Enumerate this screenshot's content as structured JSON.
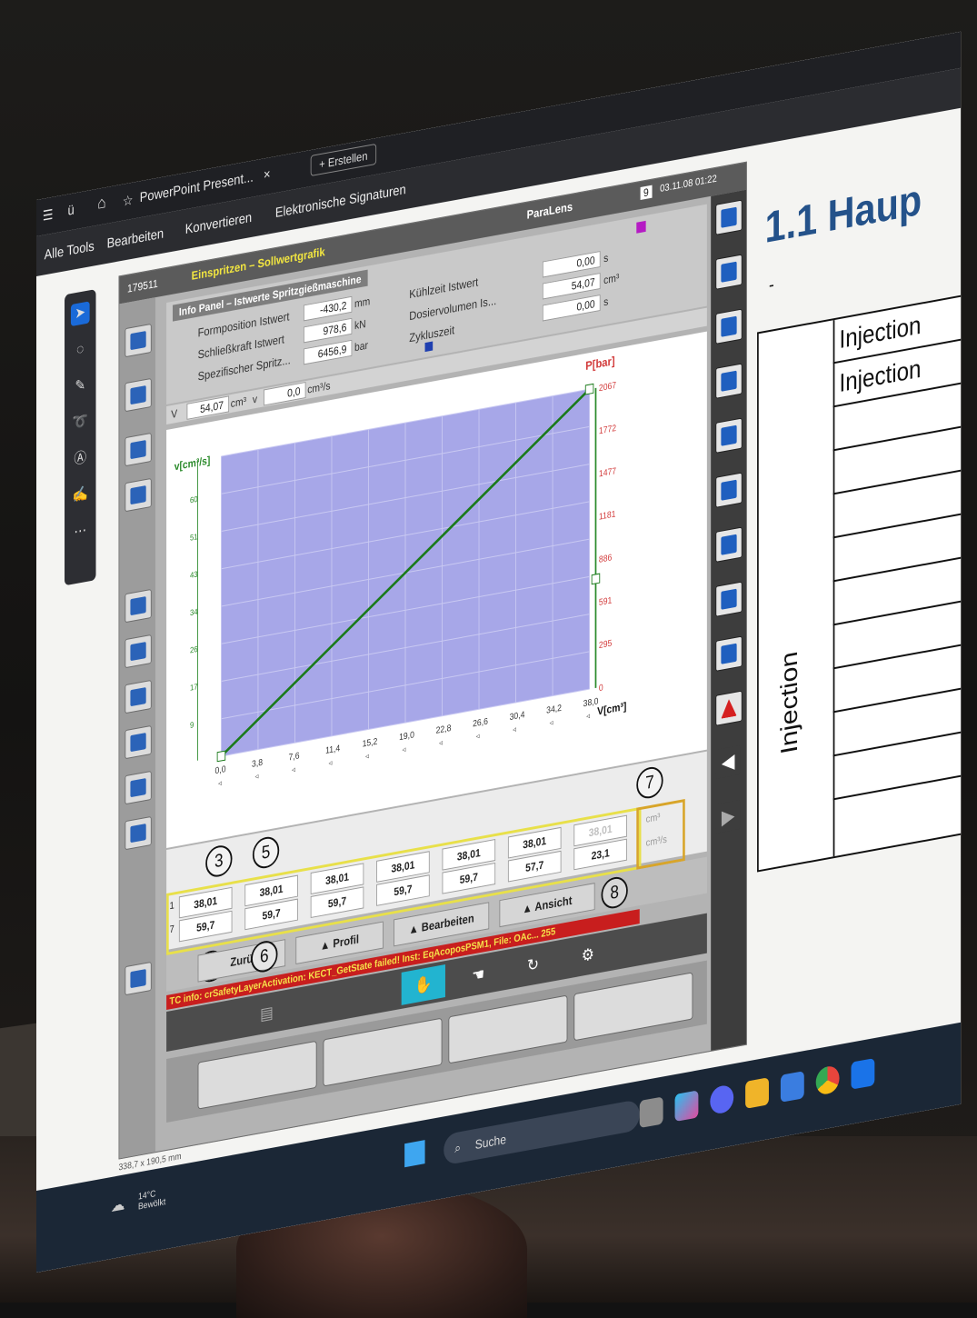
{
  "browser": {
    "tab_title": "PowerPoint Present...",
    "tab_close": "×",
    "new_tab": "+ Erstellen",
    "menu_prefix": "ü",
    "menu": [
      "Alle Tools",
      "Bearbeiten",
      "Konvertieren",
      "Elektronische Signaturen"
    ],
    "status_dims": "338,7 x 190,5 mm"
  },
  "hmi": {
    "machine_id": "179511",
    "screen_title": "Einspritzen – Sollwertgrafik",
    "brand": "ParaLens",
    "page_number": "9",
    "datetime": "03.11.08 01:22",
    "info_panel": {
      "title": "Info Panel – Istwerte Spritzgießmaschine",
      "rows": [
        {
          "label": "Formposition Istwert",
          "value": "-430,2",
          "unit": "mm"
        },
        {
          "label": "Schließkraft Istwert",
          "value": "978,6",
          "unit": "kN"
        },
        {
          "label": "Spezifischer Spritz...",
          "value": "6456,9",
          "unit": "bar"
        }
      ],
      "rows_right": [
        {
          "label": "Kühlzeit Istwert",
          "value": "0,00",
          "unit": "s"
        },
        {
          "label": "Dosiervolumen Is...",
          "value": "54,07",
          "unit": "cm³"
        },
        {
          "label": "Zykluszeit",
          "value": "0,00",
          "unit": "s"
        }
      ],
      "v_label": "V",
      "v_value": "54,07",
      "v_unit": "cm³",
      "vv_label": "v",
      "vv_value": "0,0",
      "vv_unit": "cm³/s"
    },
    "chart_title_left": "v[cm³/s]",
    "chart_title_right": "P[bar]",
    "chart_xlabel": "V[cm³]",
    "table": {
      "volume_row": [
        "38,01",
        "38,01",
        "38,01",
        "38,01",
        "38,01",
        "38,01",
        "38,01"
      ],
      "speed_row": [
        "59,7",
        "59,7",
        "59,7",
        "59,7",
        "59,7",
        "57,7",
        "23,1"
      ],
      "volume_unit": "cm³",
      "speed_unit": "cm³/s",
      "left_edge_top": "1",
      "left_edge_bottom": "7"
    },
    "annotations": [
      "3",
      "5",
      "7",
      "4",
      "6",
      "8"
    ],
    "buttons": {
      "back": "Zurü",
      "profile": "Profil",
      "edit": "Bearbeiten",
      "view": "Ansicht"
    },
    "error_text": "TC info: crSafetyLayerActivation: KECT_GetState failed!  Inst: EqAcoposPSM1, File: OAc... 255"
  },
  "slide": {
    "title": "1.1 Haup",
    "dash": "-",
    "rows": [
      "Injection",
      "Injection"
    ],
    "vertical_label": "Injection"
  },
  "taskbar": {
    "temperature": "14°C",
    "weather": "Bewölkt",
    "search": "Suche"
  },
  "chart_data": {
    "type": "line",
    "xlabel": "V[cm³]",
    "ylabel": "v[cm³/s]",
    "y2label": "P[bar]",
    "x_ticks": [
      "0,0",
      "3,8",
      "7,6",
      "11,4",
      "15,2",
      "19,0",
      "22,8",
      "26,6",
      "30,4",
      "34,2",
      "38,0"
    ],
    "y_ticks": [
      "9",
      "17",
      "26",
      "34",
      "43",
      "51",
      "60"
    ],
    "y2_ticks": [
      "0",
      "295",
      "591",
      "886",
      "1181",
      "1477",
      "1772",
      "2067"
    ],
    "xlim": [
      0,
      38
    ],
    "ylim": [
      0,
      68
    ],
    "y2lim": [
      0,
      2067
    ],
    "series": [
      {
        "x": [
          0,
          38.0
        ],
        "y2": [
          0,
          2067
        ]
      }
    ],
    "colors": {
      "plot_bg": "#a7a7e8",
      "line": "#1a7a1a",
      "left_axis": "#2a8a2a",
      "right_axis": "#d23a3a"
    }
  }
}
